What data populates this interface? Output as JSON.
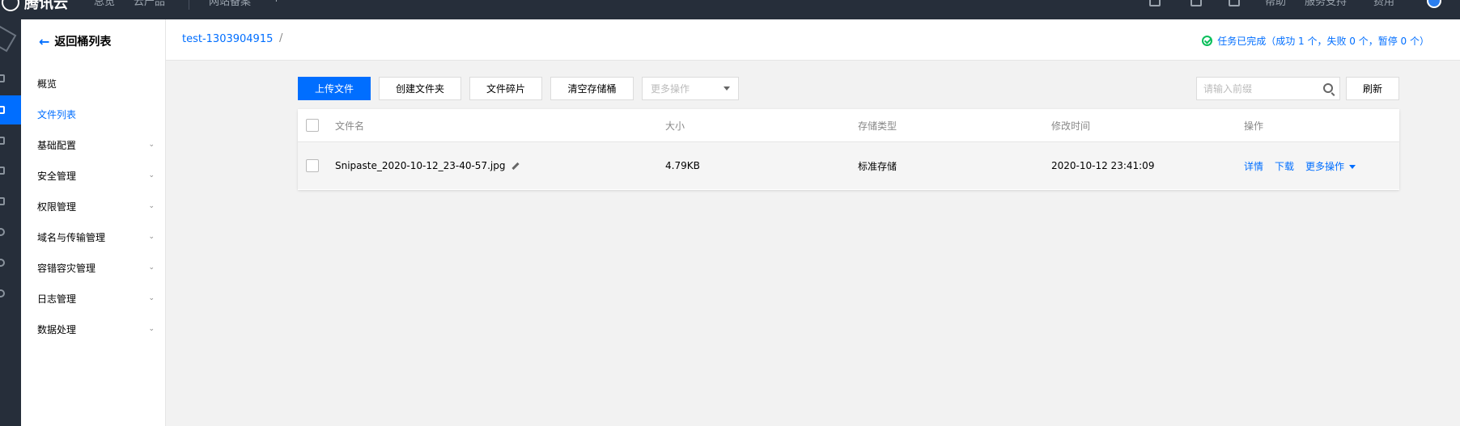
{
  "topbar": {
    "brand": "腾讯云",
    "nav": [
      "总览",
      "云产品",
      "网站备案",
      "+"
    ],
    "right_links": [
      "帮助",
      "服务支持",
      "费用"
    ],
    "icons": [
      "ticket-icon",
      "document-icon",
      "cart-icon"
    ]
  },
  "sidebar": {
    "back_label": "返回桶列表",
    "items": [
      {
        "label": "概览",
        "expandable": false
      },
      {
        "label": "文件列表",
        "expandable": false,
        "active": true
      },
      {
        "label": "基础配置",
        "expandable": true
      },
      {
        "label": "安全管理",
        "expandable": true
      },
      {
        "label": "权限管理",
        "expandable": true
      },
      {
        "label": "域名与传输管理",
        "expandable": true
      },
      {
        "label": "容错容灾管理",
        "expandable": true
      },
      {
        "label": "日志管理",
        "expandable": true
      },
      {
        "label": "数据处理",
        "expandable": true
      }
    ]
  },
  "header": {
    "bucket": "test-1303904915",
    "path_sep": "/",
    "task_status": "任务已完成（成功 1 个，失败 0 个，暂停 0 个）"
  },
  "toolbar": {
    "upload": "上传文件",
    "create_folder": "创建文件夹",
    "fragments": "文件碎片",
    "clear_bucket": "清空存储桶",
    "more_placeholder": "更多操作",
    "search_placeholder": "请输入前缀",
    "refresh": "刷新"
  },
  "table": {
    "columns": [
      "文件名",
      "大小",
      "存储类型",
      "修改时间",
      "操作"
    ],
    "rows": [
      {
        "name": "Snipaste_2020-10-12_23-40-57.jpg",
        "size": "4.79KB",
        "storage_class": "标准存储",
        "modified": "2020-10-12 23:41:09",
        "actions": [
          "详情",
          "下载",
          "更多操作"
        ]
      }
    ]
  },
  "colors": {
    "primary": "#006eff",
    "topbar": "#262e3a",
    "success": "#0abf5b"
  }
}
